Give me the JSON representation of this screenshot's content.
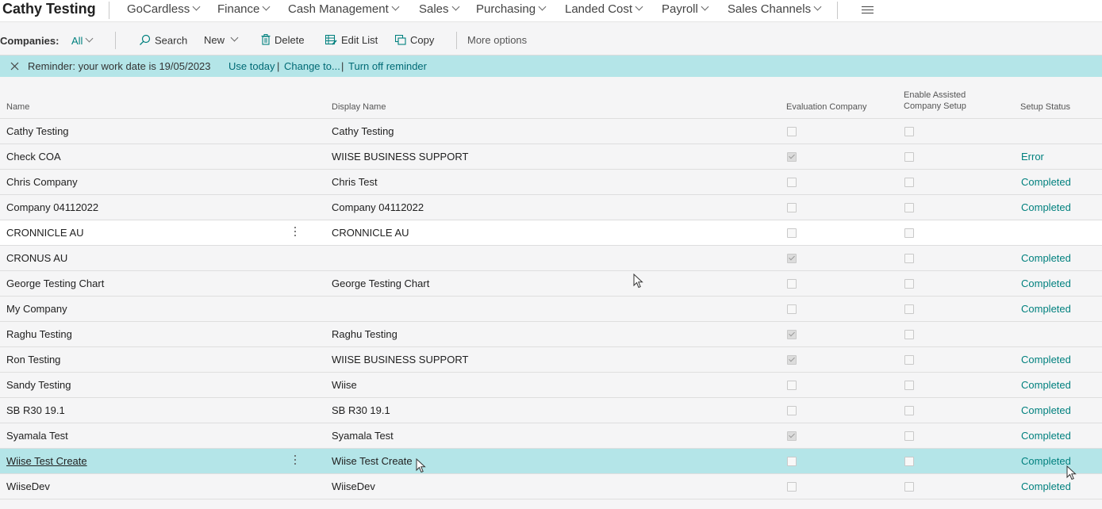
{
  "app": {
    "title": "Cathy Testing"
  },
  "nav": [
    {
      "label": "GoCardless"
    },
    {
      "label": "Finance"
    },
    {
      "label": "Cash Management"
    },
    {
      "label": "Sales"
    },
    {
      "label": "Purchasing"
    },
    {
      "label": "Landed Cost"
    },
    {
      "label": "Payroll"
    },
    {
      "label": "Sales Channels"
    }
  ],
  "actionbar": {
    "companies_label": "Companies:",
    "filter_value": "All",
    "search": "Search",
    "new": "New",
    "delete": "Delete",
    "edit_list": "Edit List",
    "copy": "Copy",
    "more_options": "More options"
  },
  "reminder": {
    "text": "Reminder: your work date is 19/05/2023",
    "use_today": "Use today",
    "change_to": "Change to...",
    "turn_off": "Turn off reminder",
    "separator": "|"
  },
  "columns": {
    "name": "Name",
    "display_name": "Display Name",
    "evaluation": "Evaluation Company",
    "assisted_line1": "Enable Assisted",
    "assisted_line2": "Company Setup",
    "setup_status": "Setup Status"
  },
  "rows": [
    {
      "name": "Cathy Testing",
      "display": "Cathy Testing",
      "evaluation": false,
      "assisted": false,
      "status": ""
    },
    {
      "name": "Check COA",
      "display": "WIISE BUSINESS SUPPORT",
      "evaluation": true,
      "assisted": false,
      "status": "Error"
    },
    {
      "name": "Chris Company",
      "display": "Chris Test",
      "evaluation": false,
      "assisted": false,
      "status": "Completed"
    },
    {
      "name": "Company 04112022",
      "display": "Company 04112022",
      "evaluation": false,
      "assisted": false,
      "status": "Completed"
    },
    {
      "name": "CRONNICLE AU",
      "display": "CRONNICLE AU",
      "evaluation": false,
      "assisted": false,
      "status": ""
    },
    {
      "name": "CRONUS AU",
      "display": "",
      "evaluation": true,
      "assisted": false,
      "status": "Completed"
    },
    {
      "name": "George Testing Chart",
      "display": "George Testing Chart",
      "evaluation": false,
      "assisted": false,
      "status": "Completed"
    },
    {
      "name": "My Company",
      "display": "",
      "evaluation": false,
      "assisted": false,
      "status": "Completed"
    },
    {
      "name": "Raghu Testing",
      "display": "Raghu Testing",
      "evaluation": true,
      "assisted": false,
      "status": ""
    },
    {
      "name": "Ron Testing",
      "display": "WIISE BUSINESS SUPPORT",
      "evaluation": true,
      "assisted": false,
      "status": "Completed"
    },
    {
      "name": "Sandy Testing",
      "display": "Wiise",
      "evaluation": false,
      "assisted": false,
      "status": "Completed"
    },
    {
      "name": "SB R30 19.1",
      "display": "SB R30 19.1",
      "evaluation": false,
      "assisted": false,
      "status": "Completed"
    },
    {
      "name": "Syamala Test",
      "display": "Syamala Test",
      "evaluation": true,
      "assisted": false,
      "status": "Completed"
    },
    {
      "name": "Wiise Test Create",
      "display": "Wiise Test Create",
      "evaluation": false,
      "assisted": false,
      "status": "Completed"
    },
    {
      "name": "WiiseDev",
      "display": "WiiseDev",
      "evaluation": false,
      "assisted": false,
      "status": "Completed"
    }
  ]
}
